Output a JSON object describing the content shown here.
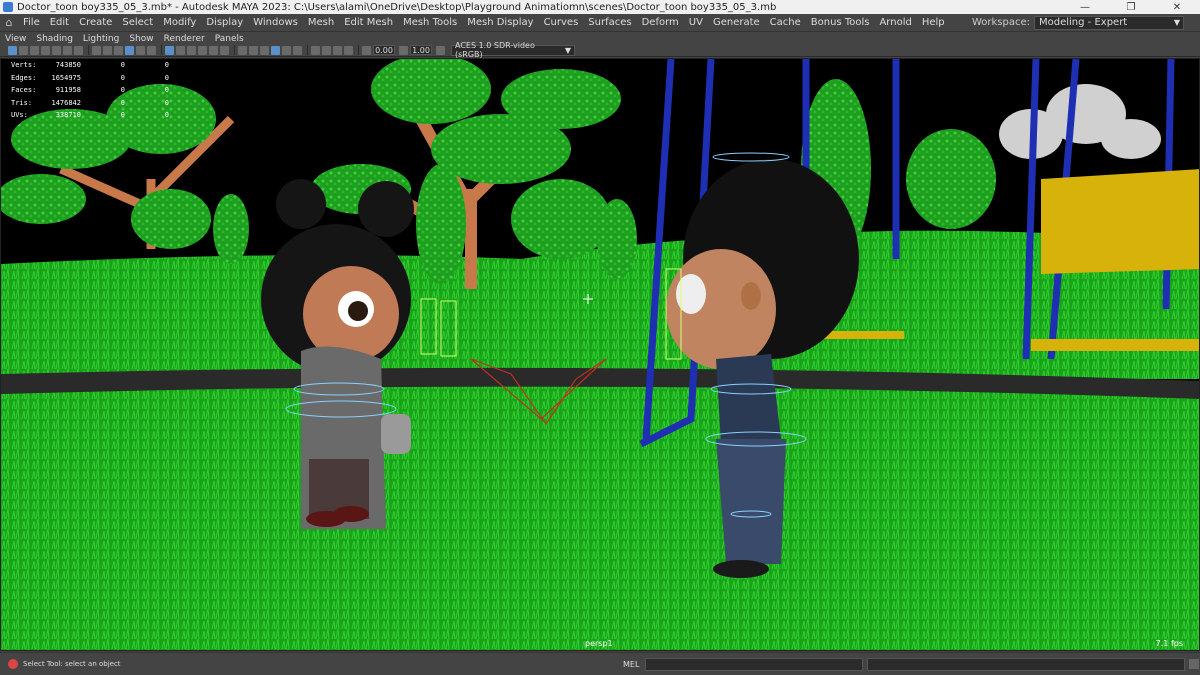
{
  "window": {
    "title": "Doctor_toon boy335_05_3.mb* - Autodesk MAYA 2023: C:\\Users\\alami\\OneDrive\\Desktop\\Playground Animatiomn\\scenes\\Doctor_toon boy335_05_3.mb",
    "minimize_glyph": "—",
    "maximize_glyph": "❐",
    "close_glyph": "✕"
  },
  "menubar": {
    "items": [
      "File",
      "Edit",
      "Create",
      "Select",
      "Modify",
      "Display",
      "Windows",
      "Mesh",
      "Edit Mesh",
      "Mesh Tools",
      "Mesh Display",
      "Curves",
      "Surfaces",
      "Deform",
      "UV",
      "Generate",
      "Cache",
      "Bonus Tools",
      "Arnold",
      "Help"
    ],
    "workspace_label": "Workspace:",
    "workspace_value": "Modeling - Expert"
  },
  "panel_menu": {
    "items": [
      "View",
      "Shading",
      "Lighting",
      "Show",
      "Renderer",
      "Panels"
    ]
  },
  "panel_toolbar": {
    "exposure": "0.00",
    "gamma": "1.00",
    "color_space": "ACES 1.0 SDR-video (sRGB)"
  },
  "viewport": {
    "hud": [
      {
        "label": "Verts:",
        "value": "743850",
        "selected": "0",
        "tris": "0"
      },
      {
        "label": "Edges:",
        "value": "1654975",
        "selected": "0",
        "tris": "0"
      },
      {
        "label": "Faces:",
        "value": "911958",
        "selected": "0",
        "tris": "0"
      },
      {
        "label": "Tris:",
        "value": "1476842",
        "selected": "0",
        "tris": "0"
      },
      {
        "label": "UVs:",
        "value": "338710",
        "selected": "0",
        "tris": "0"
      }
    ],
    "camera": "persp1",
    "fps": "7.1 fps"
  },
  "statusbar": {
    "help_line": "Select Tool: select an object",
    "mel_label": "MEL"
  },
  "colors": {
    "grass": "#1fae1f",
    "sky": "#000000",
    "tree_foliage": "#2dbb2d",
    "tree_trunk": "#c8794a",
    "swing_frame": "#1e2fb4"
  }
}
